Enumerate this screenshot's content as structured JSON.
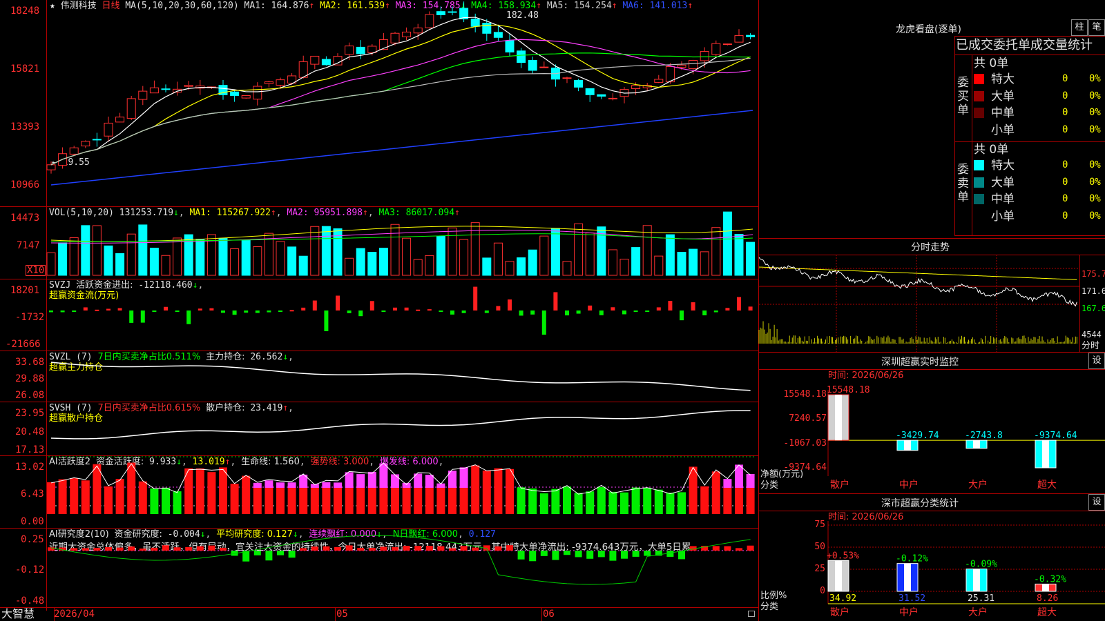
{
  "stock": {
    "star": "★",
    "name": "伟测科技",
    "period": "日线"
  },
  "main_chart": {
    "ma_header": "MA(5,10,20,30,60,120)",
    "ma1": "MA1: 164.876",
    "ma1_arrow": "↑",
    "ma2": "MA2: 161.539",
    "ma2_arrow": "↑",
    "ma3": "MA3: 154.785",
    "ma3_arrow": "↓",
    "ma4": "MA4: 158.934",
    "ma4_arrow": "↑",
    "ma5": "MA5: 154.254",
    "ma5_arrow": "↑",
    "ma6": "MA6: 141.013",
    "ma6_arrow": "↑",
    "high_mark": "182.48",
    "low_mark": "←119.55",
    "y_labels": [
      "18248",
      "15821",
      "13393",
      "10966"
    ]
  },
  "vol": {
    "header": "VOL(5,10,20)",
    "value": "131253.719",
    "value_arrow": "↓",
    "ma1": "MA1: 115267.922",
    "ma1_arrow": "↑",
    "ma2": "MA2: 95951.898",
    "ma2_arrow": "↑",
    "ma3": "MA3: 86017.094",
    "ma3_arrow": "↑",
    "y_labels": [
      "14473",
      "7147"
    ],
    "unit": "X10"
  },
  "svzj": {
    "header": "SVZJ",
    "label": "活跃资金进出:",
    "value": "-12118.460",
    "arrow": "↓",
    "sub": "超赢资金流(万元)",
    "y_labels": [
      "18201",
      "-1732",
      "-21666"
    ]
  },
  "svzl": {
    "header": "SVZL (7)",
    "note": "7日内买卖净占比0.511%",
    "label": "主力持仓:",
    "value": "26.562",
    "arrow": "↓",
    "sub": "超赢主力持仓",
    "y_labels": [
      "33.68",
      "29.88",
      "26.08"
    ]
  },
  "svsh": {
    "header": "SVSH (7)",
    "note": "7日内买卖净占比0.615%",
    "label": "散户持仓:",
    "value": "23.419",
    "arrow": "↑",
    "sub": "超赢散户持仓",
    "y_labels": [
      "23.95",
      "20.48",
      "17.13"
    ]
  },
  "ai_active": {
    "header": "AI活跃度2",
    "label": "资金活跃度:",
    "value": "9.933",
    "arrow": "↓",
    "v2": "13.019",
    "v2_arrow": "↑",
    "life": "生命线: 1.560",
    "strong": "强势线: 3.000",
    "burst": "爆发线: 6.000",
    "y_labels": [
      "13.02",
      "6.43",
      "0.00"
    ]
  },
  "ai_research": {
    "header": "AI研究度2(10)",
    "label": "资金研究度:",
    "value": "-0.004",
    "arrow": "↓",
    "avg": "平均研究度: 0.127",
    "avg_arrow": "↓",
    "streak": "连续飘红: 0.000",
    "streak_arrow": "↓",
    "ndays": "N日飘红: 6.000",
    "extra": "0.127",
    "comment": "近期大资金总体偏多，虽不活跃，但有异动，宜关注大资金的持续性，今日大单净流出: -12118.443万元，其中特大单净流出: -9374.643万元，大单5日累",
    "y_labels": [
      "0.25",
      "-0.12",
      "-0.48"
    ]
  },
  "bottom": {
    "brand": "大智慧",
    "date1": "2026/04",
    "m05": "05",
    "m06": "06"
  },
  "dragon": {
    "title": "龙虎看盘(逐单)",
    "btn1": "柱",
    "btn2": "笔",
    "tabs": "已成交委托单成交量统计",
    "buy_label": "委买单",
    "sell_label": "委卖单",
    "buy_total": "共 0单",
    "sell_total": "共 0单",
    "buy_rows": [
      {
        "name": "特大",
        "count": "0",
        "pct": "0%",
        "color": "#ff0000"
      },
      {
        "name": "大单",
        "count": "0",
        "pct": "0%",
        "color": "#990000"
      },
      {
        "name": "中单",
        "count": "0",
        "pct": "0%",
        "color": "#660000"
      },
      {
        "name": "小单",
        "count": "0",
        "pct": "0%",
        "color": ""
      }
    ],
    "sell_rows": [
      {
        "name": "特大",
        "count": "0",
        "pct": "0%",
        "color": "#00ffff"
      },
      {
        "name": "大单",
        "count": "0",
        "pct": "0%",
        "color": "#008888"
      },
      {
        "name": "中单",
        "count": "0",
        "pct": "0%",
        "color": "#006666"
      },
      {
        "name": "小单",
        "count": "0",
        "pct": "0%",
        "color": ""
      }
    ]
  },
  "intraday": {
    "title": "分时走势",
    "y_labels": [
      "175.7",
      "171.6",
      "167.6"
    ],
    "vol_label": "4544",
    "fen": "分时"
  },
  "sz_monitor": {
    "title": "深圳超赢实时监控",
    "btn": "设",
    "time": "时间: 2026/06/26",
    "y_labels": [
      "15548.18",
      "7240.57",
      "-1067.03",
      "-9374.64"
    ],
    "unit": "净额(万元)",
    "cat": "分类",
    "categories": [
      "散户",
      "中户",
      "大户",
      "超大"
    ],
    "values": [
      15548.18,
      -3429.74,
      -2743.8,
      -9374.64
    ],
    "value_labels": [
      "15548.18",
      "-3429.74",
      "-2743.8",
      "-9374.64"
    ]
  },
  "sz_class": {
    "title": "深市超赢分类统计",
    "btn": "设",
    "time": "时间: 2026/06/26",
    "y_labels": [
      "75",
      "50",
      "25",
      "0"
    ],
    "unit": "比例%",
    "cat": "分类",
    "categories": [
      "散户",
      "中户",
      "大户",
      "超大"
    ],
    "values": [
      34.92,
      31.52,
      25.31,
      8.26
    ],
    "value_labels": [
      "34.92",
      "31.52",
      "25.31",
      "8.26"
    ],
    "changes": [
      "+0.53%",
      "-0.12%",
      "-0.09%",
      "-0.32%"
    ]
  }
}
